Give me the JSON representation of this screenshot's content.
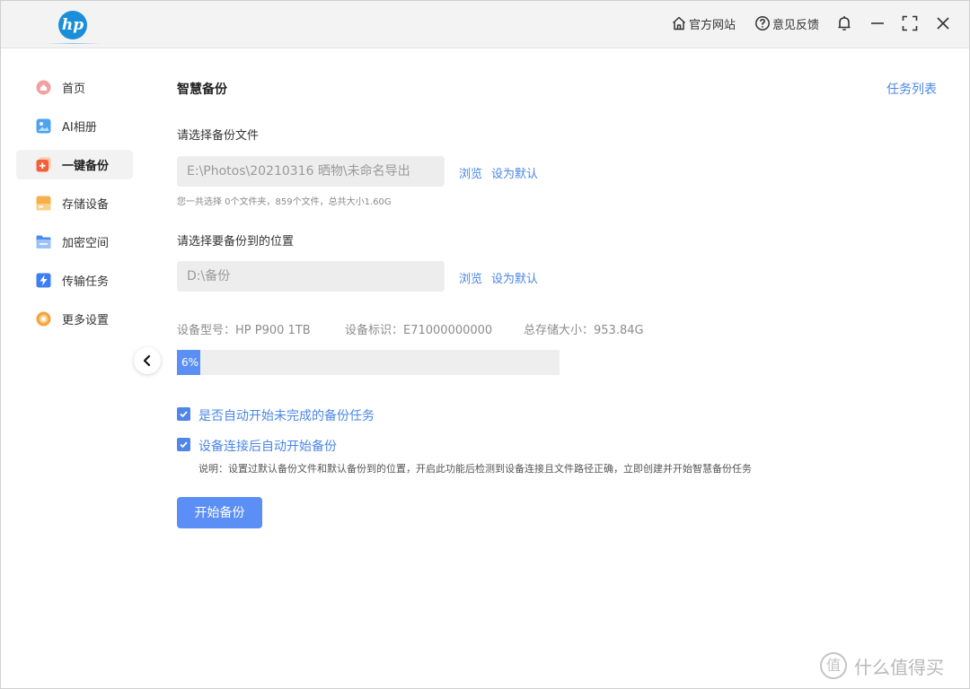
{
  "app": {
    "logo_text": "hp"
  },
  "titlebar": {
    "official_site": "官方网站",
    "feedback": "意见反馈"
  },
  "sidebar": {
    "items": [
      {
        "label": "首页",
        "icon": "home-icon",
        "color": "#f08a8a"
      },
      {
        "label": "AI相册",
        "icon": "photo-album-icon",
        "color": "#4da3f0"
      },
      {
        "label": "一键备份",
        "icon": "backup-icon",
        "color": "#f2603a"
      },
      {
        "label": "存储设备",
        "icon": "storage-device-icon",
        "color": "#f5b04a"
      },
      {
        "label": "加密空间",
        "icon": "encrypted-folder-icon",
        "color": "#4a8df0"
      },
      {
        "label": "传输任务",
        "icon": "transfer-icon",
        "color": "#3d7ef0"
      },
      {
        "label": "更多设置",
        "icon": "settings-icon",
        "color": "#f5a23a"
      }
    ],
    "active_index": 2
  },
  "main": {
    "title": "智慧备份",
    "task_list": "任务列表",
    "source": {
      "label": "请选择备份文件",
      "path": "E:\\Photos\\20210316 晒物\\未命名导出",
      "browse": "浏览",
      "set_default": "设为默认",
      "summary": "您一共选择 0个文件夹，859个文件，总共大小1.60G"
    },
    "destination": {
      "label": "请选择要备份到的位置",
      "path": "D:\\备份",
      "browse": "浏览",
      "set_default": "设为默认"
    },
    "device": {
      "model": "设备型号：HP P900 1TB",
      "id": "设备标识：E71000000000",
      "capacity": "总存储大小：953.84G"
    },
    "progress": {
      "percent": 6,
      "label": "6%"
    },
    "options": [
      {
        "label": "是否自动开始未完成的备份任务",
        "checked": true
      },
      {
        "label": "设备连接后自动开始备份",
        "checked": true
      }
    ],
    "note": "说明：设置过默认备份文件和默认备份到的位置，开启此功能后检测到设备连接且文件路径正确，立即创建并开始智慧备份任务",
    "start_button": "开始备份"
  },
  "watermark": {
    "badge": "值",
    "text": "什么值得买"
  },
  "colors": {
    "accent": "#5b8ff5",
    "link": "#4a86e8"
  }
}
